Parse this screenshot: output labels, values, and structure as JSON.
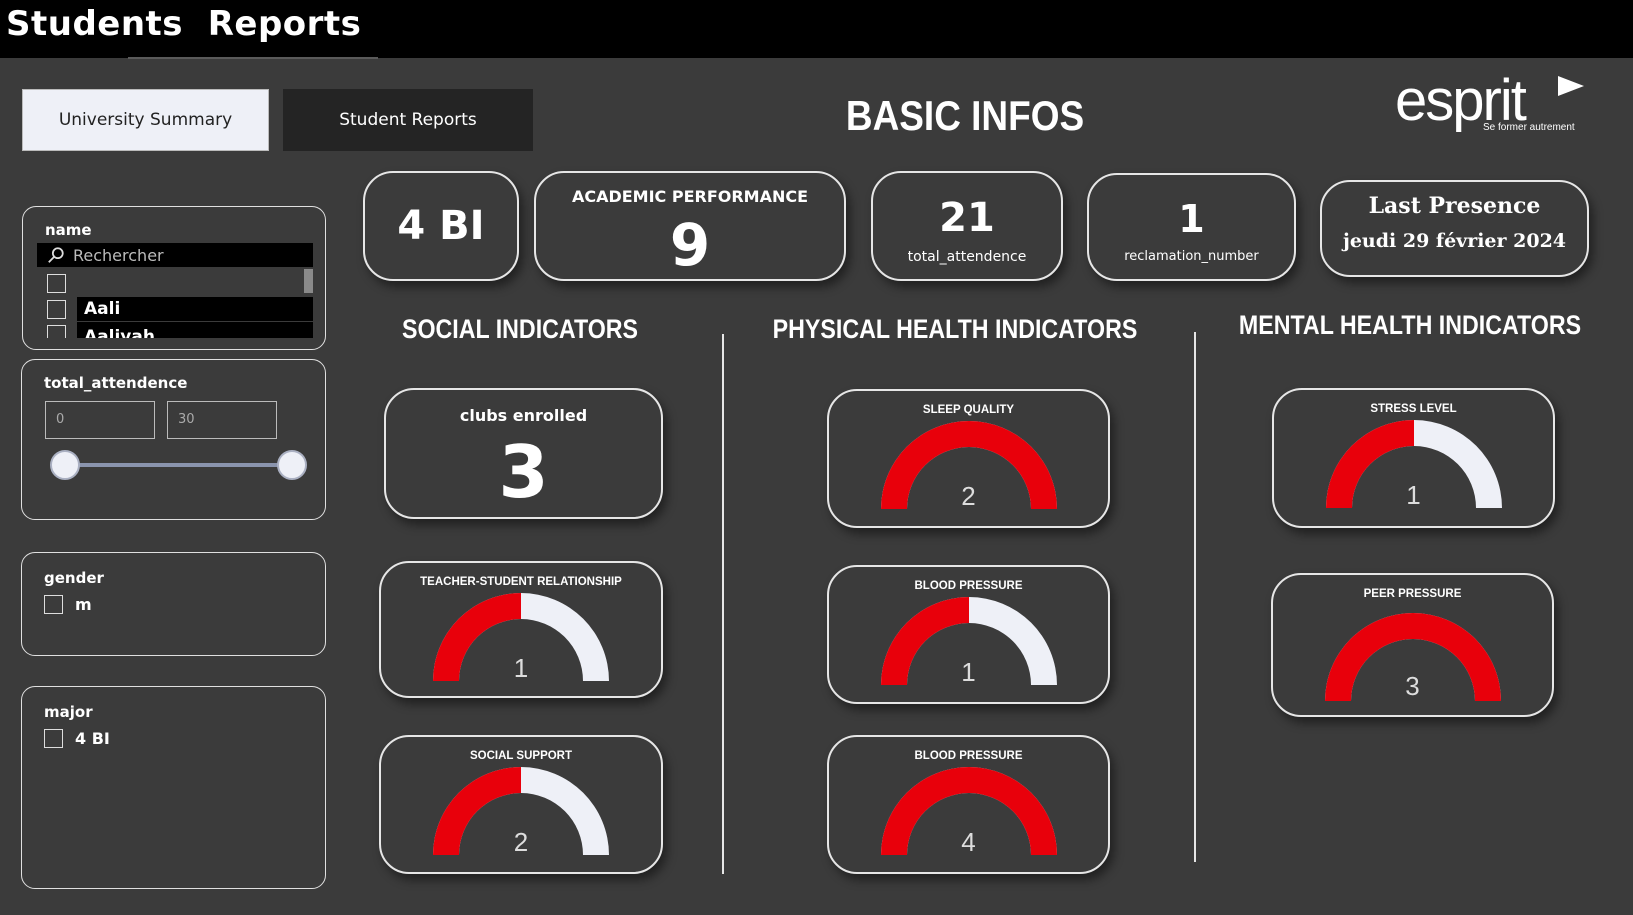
{
  "header": {
    "title": "Students  Reports"
  },
  "nav": {
    "university_summary": "University Summary",
    "student_reports": "Student Reports"
  },
  "page_heading": "BASIC INFOS",
  "logo": {
    "wordmark": "esprit",
    "tagline": "Se former autrement"
  },
  "filters": {
    "name": {
      "title": "name",
      "search_placeholder": "Rechercher",
      "items": [
        "",
        "Aali",
        "Aaliyah"
      ]
    },
    "attendance": {
      "title": "total_attendence",
      "min": "0",
      "max": "30"
    },
    "gender": {
      "title": "gender",
      "option": "m"
    },
    "major": {
      "title": "major",
      "option": "4 BI"
    }
  },
  "kpis": {
    "major": "4 BI",
    "academic_performance": {
      "label": "ACADEMIC PERFORMANCE",
      "value": "9"
    },
    "total_attendence": {
      "value": "21",
      "label": "total_attendence"
    },
    "reclamation_number": {
      "value": "1",
      "label": "reclamation_number"
    },
    "last_presence": {
      "label": "Last Presence",
      "value": "jeudi 29 février 2024"
    }
  },
  "sections": {
    "social": "SOCIAL INDICATORS",
    "physical": "PHYSICAL HEALTH INDICATORS",
    "mental": "MENTAL HEALTH INDICATORS"
  },
  "social": {
    "clubs": {
      "label": "clubs enrolled",
      "value": "3"
    },
    "gauges": [
      {
        "title": "TEACHER-STUDENT RELATIONSHIP",
        "value": 1,
        "max": 2
      },
      {
        "title": "SOCIAL SUPPORT",
        "value": 2,
        "max": 4
      }
    ]
  },
  "physical": {
    "gauges": [
      {
        "title": "SLEEP QUALITY",
        "value": 2,
        "max": 2
      },
      {
        "title": "BLOOD PRESSURE",
        "value": 1,
        "max": 2
      },
      {
        "title": "BLOOD PRESSURE",
        "value": 4,
        "max": 4
      }
    ]
  },
  "mental": {
    "gauges": [
      {
        "title": "STRESS LEVEL",
        "value": 1,
        "max": 2
      },
      {
        "title": "PEER PRESSURE",
        "value": 3,
        "max": 3
      }
    ]
  },
  "colors": {
    "gauge_fill": "#e8000b",
    "gauge_track": "#eef0f7",
    "background": "#3b3b3b"
  }
}
